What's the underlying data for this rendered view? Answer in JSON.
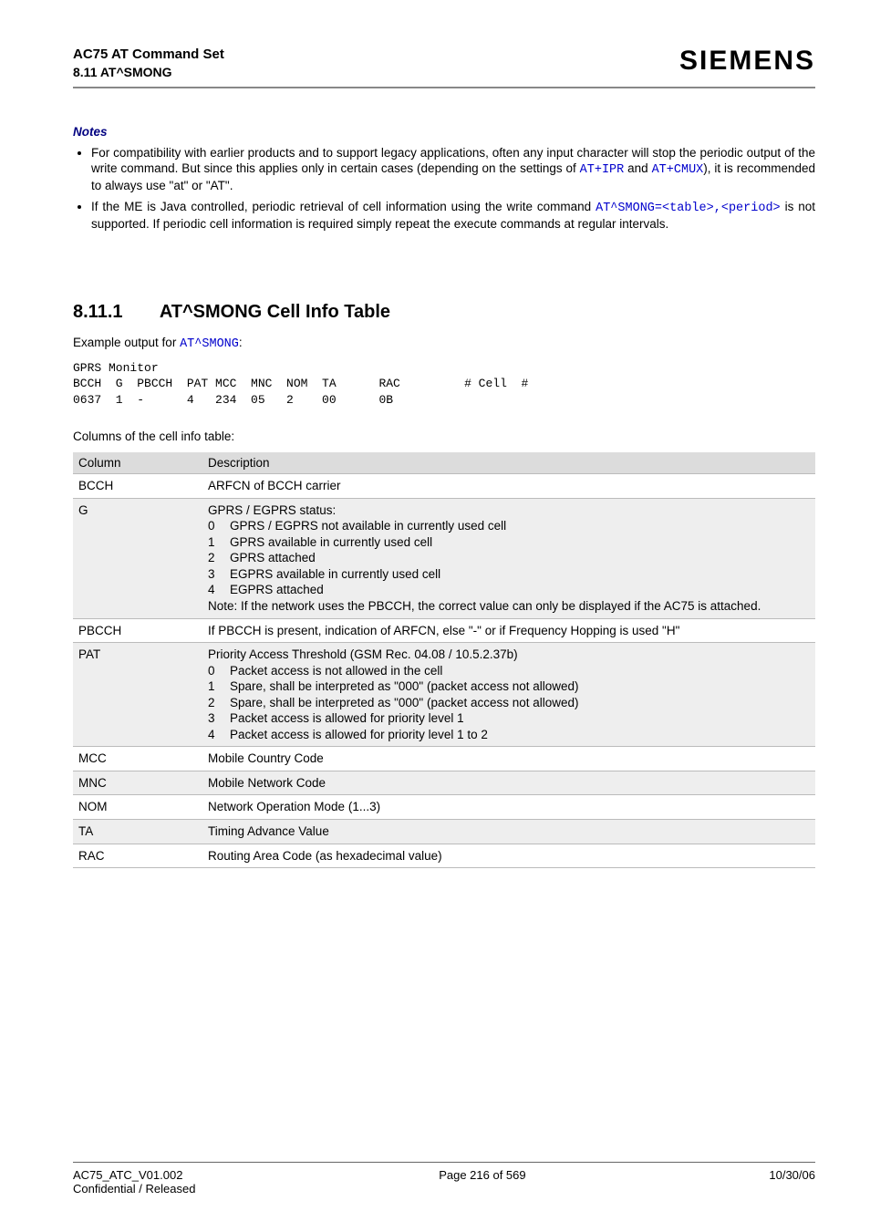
{
  "header": {
    "title": "AC75 AT Command Set",
    "subtitle": "8.11 AT^SMONG",
    "brand": "SIEMENS"
  },
  "notes": {
    "heading": "Notes",
    "items": [
      {
        "pre": "For compatibility with earlier products and to support legacy applications, often any input character will stop the periodic output of the write command. But since this applies only in certain cases (depending on the settings of ",
        "link1": "AT+IPR",
        "mid1": " and ",
        "link2": "AT+CMUX",
        "post": "), it is recommended to always use \"at\" or \"AT\"."
      },
      {
        "pre": "If the ME is Java controlled, periodic retrieval of cell information using the write command ",
        "link1": "AT^SMONG",
        "eq": "=",
        "link2": "<table>",
        "comma": ",",
        "link3": "<period>",
        "post": " is not supported. If periodic cell information is required simply repeat the execute commands at regular intervals."
      }
    ]
  },
  "section": {
    "num": "8.11.1",
    "title": "AT^SMONG Cell Info Table",
    "example_pre": "Example output for ",
    "example_link": "AT^SMONG",
    "example_post": ":",
    "mono": "GPRS Monitor\nBCCH  G  PBCCH  PAT MCC  MNC  NOM  TA      RAC         # Cell  #\n0637  1  -      4   234  05   2    00      0B",
    "cols_caption": "Columns of the cell info table:"
  },
  "table": {
    "head_col": "Column",
    "head_desc": "Description",
    "rows": [
      {
        "col": "BCCH",
        "desc_plain": "ARFCN of BCCH carrier"
      },
      {
        "col": "G",
        "desc_lead": "GPRS / EGPRS status:",
        "enums": [
          {
            "n": "0",
            "t": "GPRS / EGPRS not available in currently used cell"
          },
          {
            "n": "1",
            "t": "GPRS available in currently used cell"
          },
          {
            "n": "2",
            "t": "GPRS attached"
          },
          {
            "n": "3",
            "t": "EGPRS available in currently used cell"
          },
          {
            "n": "4",
            "t": "EGPRS attached"
          }
        ],
        "desc_trail": "Note: If the network uses the PBCCH, the correct value can only be displayed if the AC75 is attached."
      },
      {
        "col": "PBCCH",
        "desc_plain": "If PBCCH is present, indication of ARFCN, else \"-\" or if Frequency Hopping is used \"H\""
      },
      {
        "col": "PAT",
        "desc_lead": "Priority Access Threshold (GSM Rec. 04.08 / 10.5.2.37b)",
        "enums": [
          {
            "n": "0",
            "t": "Packet access is not allowed in the cell"
          },
          {
            "n": "1",
            "t": "Spare, shall be interpreted as \"000\" (packet access not allowed)"
          },
          {
            "n": "2",
            "t": "Spare, shall be interpreted as \"000\" (packet access not allowed)"
          },
          {
            "n": "3",
            "t": "Packet access is allowed for priority level 1"
          },
          {
            "n": "4",
            "t": "Packet access is allowed for priority level 1 to 2"
          }
        ]
      },
      {
        "col": "MCC",
        "desc_plain": "Mobile Country Code"
      },
      {
        "col": "MNC",
        "desc_plain": "Mobile Network Code"
      },
      {
        "col": "NOM",
        "desc_plain": "Network Operation Mode (1...3)"
      },
      {
        "col": "TA",
        "desc_plain": "Timing Advance Value"
      },
      {
        "col": "RAC",
        "desc_plain": "Routing Area Code (as hexadecimal value)"
      }
    ]
  },
  "footer": {
    "left1": "AC75_ATC_V01.002",
    "left2": "Confidential / Released",
    "center": "Page 216 of 569",
    "right": "10/30/06"
  }
}
